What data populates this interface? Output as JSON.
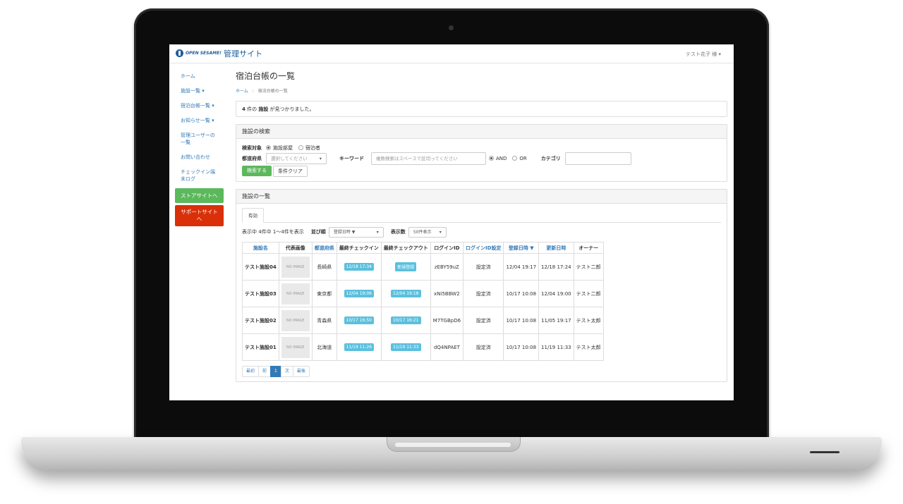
{
  "header": {
    "logo_text": "OPEN SESAME!",
    "site_title": "管理サイト",
    "user_menu": "テスト花子 様 ▾"
  },
  "sidebar": {
    "items": [
      {
        "label": "ホーム"
      },
      {
        "label": "施設一覧 ▾"
      },
      {
        "label": "宿泊台帳一覧 ▾"
      },
      {
        "label": "お知らせ一覧 ▾"
      },
      {
        "label": "管理ユーザーの一覧"
      },
      {
        "label": "お問い合わせ"
      },
      {
        "label": "チェックイン端末ログ"
      }
    ],
    "store_button": "ストアサイトへ",
    "support_button": "サポートサイトへ"
  },
  "page": {
    "title": "宿泊台帳の一覧",
    "breadcrumb_home": "ホーム",
    "breadcrumb_sep": "/",
    "breadcrumb_current": "宿泊台帳の一覧",
    "result_count": "4",
    "result_text_1": " 件の ",
    "result_facility": "施設",
    "result_text_2": " が見つかりました。"
  },
  "search": {
    "heading": "施設の検索",
    "target_label": "検索対象",
    "target_options": [
      "施設部屋",
      "宿泊者"
    ],
    "pref_label": "都道府県",
    "pref_placeholder": "選択してください",
    "keyword_label": "キーワード",
    "keyword_placeholder": "複数検索はスペースで区切ってください",
    "logic_options": [
      "AND",
      "OR"
    ],
    "category_label": "カテゴリ",
    "search_button": "検索する",
    "clear_button": "条件クリア"
  },
  "list": {
    "heading": "施設の一覧",
    "tab": "有効",
    "showing": "表示中 4件中 1〜4件を表示",
    "sort_label": "並び順",
    "sort_value": "登録日時 ▼",
    "perpage_label": "表示数",
    "perpage_value": "50件表示",
    "columns": [
      "施設名",
      "代表画像",
      "都道府県",
      "最終チェックイン",
      "最終チェックアウト",
      "ログインID",
      "ログインID設定",
      "登録日時 ▼",
      "更新日時",
      "オーナー"
    ],
    "no_image": "NO IMAGE",
    "rows": [
      {
        "name": "テスト施設04",
        "pref": "長崎県",
        "checkin": "12/18 17:34",
        "checkout": "新規登録",
        "login_id": "zEBY59uZ",
        "login_set": "設定済",
        "created": "12/04 19:17",
        "updated": "12/18 17:24",
        "owner": "テスト二郎"
      },
      {
        "name": "テスト施設03",
        "pref": "東京都",
        "checkin": "12/04 19:06",
        "checkout": "12/04 19:18",
        "login_id": "xNi5BBW2",
        "login_set": "設定済",
        "created": "10/17 10:08",
        "updated": "12/04 19:00",
        "owner": "テスト二郎"
      },
      {
        "name": "テスト施設02",
        "pref": "青森県",
        "checkin": "10/17 16:50",
        "checkout": "10/17 16:21",
        "login_id": "M7TGBpD6",
        "login_set": "設定済",
        "created": "10/17 10:08",
        "updated": "11/05 19:17",
        "owner": "テスト太郎"
      },
      {
        "name": "テスト施設01",
        "pref": "北海道",
        "checkin": "11/19 11:26",
        "checkout": "11/19 11:33",
        "login_id": "dQ4NPAET",
        "login_set": "設定済",
        "created": "10/17 10:08",
        "updated": "11/19 11:33",
        "owner": "テスト太郎"
      }
    ],
    "pagination": [
      "最初",
      "前",
      "1",
      "次",
      "最後"
    ]
  },
  "colors": {
    "brand": "#1f5c9a",
    "link": "#337ab7",
    "success": "#5cb85c",
    "danger": "#d9300a",
    "info": "#5bc0de"
  }
}
